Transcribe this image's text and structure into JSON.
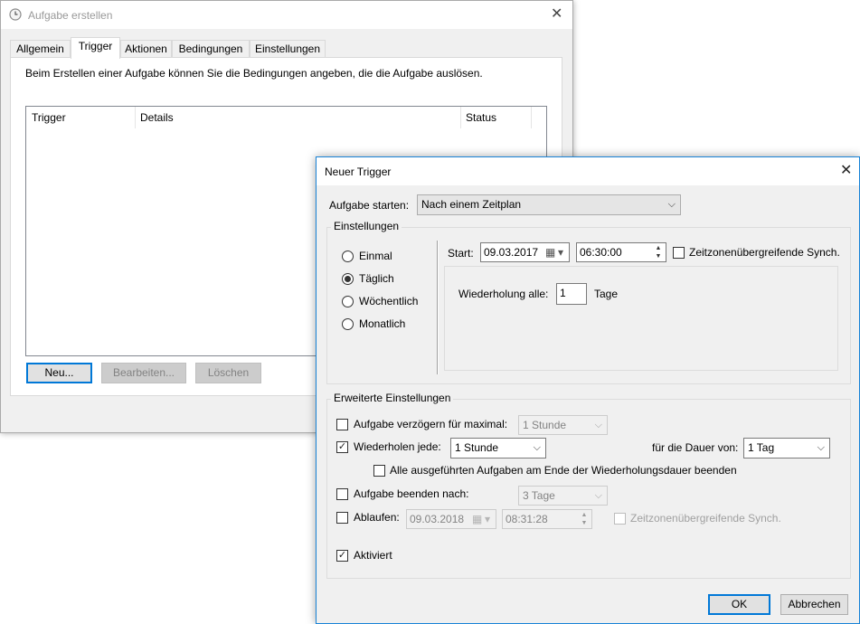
{
  "main_window": {
    "title": "Aufgabe erstellen",
    "close_glyph": "✕",
    "icon": "clock-icon",
    "tabs": [
      {
        "label": "Allgemein"
      },
      {
        "label": "Trigger"
      },
      {
        "label": "Aktionen"
      },
      {
        "label": "Bedingungen"
      },
      {
        "label": "Einstellungen"
      }
    ],
    "active_tab": "Trigger",
    "description": "Beim Erstellen einer Aufgabe können Sie die Bedingungen angeben, die die Aufgabe auslösen.",
    "columns": [
      "Trigger",
      "Details",
      "Status"
    ],
    "buttons": {
      "new": "Neu...",
      "edit": "Bearbeiten...",
      "delete": "Löschen"
    }
  },
  "trigger_dialog": {
    "title": "Neuer Trigger",
    "close_glyph": "✕",
    "start_task_label": "Aufgabe starten:",
    "start_task_value": "Nach einem Zeitplan",
    "settings_group": "Einstellungen",
    "schedule_options": [
      "Einmal",
      "Täglich",
      "Wöchentlich",
      "Monatlich"
    ],
    "selected_schedule": "Täglich",
    "start_label": "Start:",
    "start_date": "09.03.2017",
    "start_time": "06:30:00",
    "sync_timezones_label": "Zeitzonenübergreifende Synch.",
    "recur_label": "Wiederholung alle:",
    "recur_value": "1",
    "recur_unit": "Tage",
    "advanced_group": "Erweiterte Einstellungen",
    "delay_label": "Aufgabe verzögern für maximal:",
    "delay_value": "1 Stunde",
    "repeat_label": "Wiederholen jede:",
    "repeat_value": "1 Stunde",
    "duration_label": "für die Dauer von:",
    "duration_value": "1 Tag",
    "stop_all_label": "Alle ausgeführten Aufgaben am Ende der Wiederholungsdauer beenden",
    "stop_after_label": "Aufgabe beenden nach:",
    "stop_after_value": "3 Tage",
    "expire_label": "Ablaufen:",
    "expire_date": "09.03.2018",
    "expire_time": "08:31:28",
    "expire_sync_label": "Zeitzonenübergreifende Synch.",
    "enabled_label": "Aktiviert",
    "ok_label": "OK",
    "cancel_label": "Abbrechen"
  },
  "glyphs": {
    "check": "✓",
    "chevron": "⌵",
    "calendar": "▦",
    "spin_up": "▲",
    "spin_down": "▼",
    "dropdown": "▾"
  },
  "colors": {
    "accent": "#0078d7",
    "window_bg": "#f0f0f0",
    "border_blue": "#1883d7"
  }
}
